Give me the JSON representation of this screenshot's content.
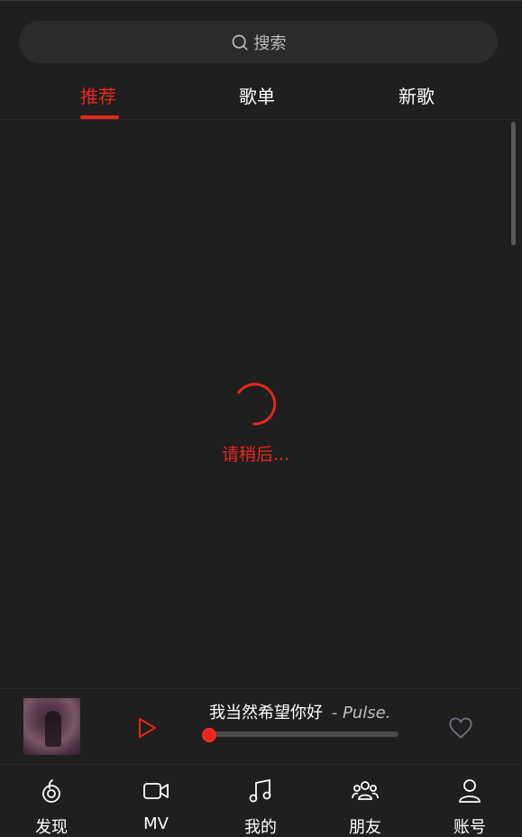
{
  "search": {
    "placeholder": "搜索"
  },
  "tabs": [
    {
      "label": "推荐",
      "active": true
    },
    {
      "label": "歌单",
      "active": false
    },
    {
      "label": "新歌",
      "active": false
    }
  ],
  "loading": {
    "text": "请稍后..."
  },
  "player": {
    "song_title": "我当然希望你好",
    "separator": "-",
    "artist": "Pulse.",
    "progress": 0,
    "liked": false
  },
  "nav": [
    {
      "label": "发现",
      "icon": "discover-icon"
    },
    {
      "label": "MV",
      "icon": "video-icon"
    },
    {
      "label": "我的",
      "icon": "music-note-icon"
    },
    {
      "label": "朋友",
      "icon": "friends-icon"
    },
    {
      "label": "账号",
      "icon": "user-icon"
    }
  ],
  "colors": {
    "accent": "#e8271c",
    "background": "#1f1f1f"
  }
}
